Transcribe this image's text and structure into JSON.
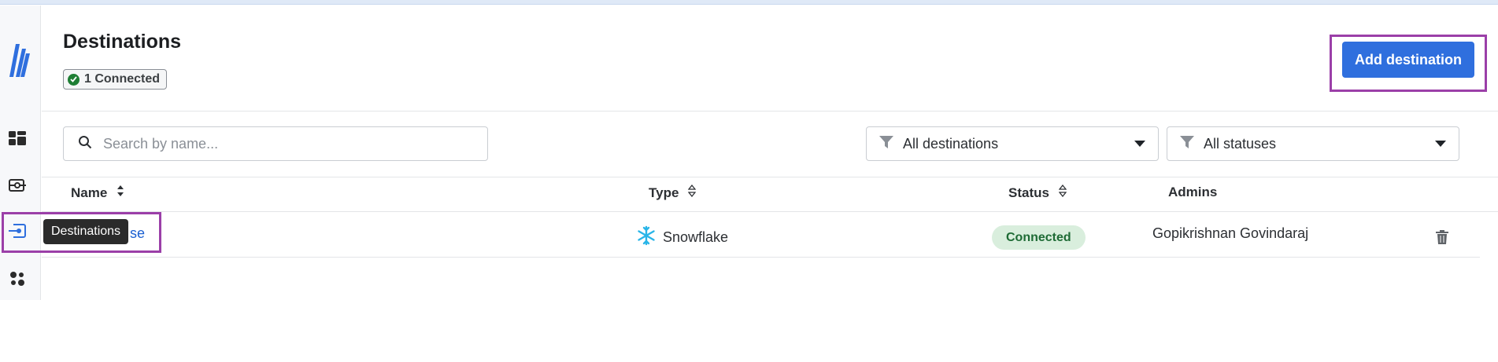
{
  "page": {
    "title": "Destinations",
    "connected_count": "1 Connected",
    "add_button": "Add destination"
  },
  "search": {
    "placeholder": "Search by name..."
  },
  "filters": {
    "destinations": "All destinations",
    "statuses": "All statuses"
  },
  "table": {
    "columns": {
      "name": "Name",
      "type": "Type",
      "status": "Status",
      "admins": "Admins"
    },
    "rows": [
      {
        "name": "se",
        "type": "Snowflake",
        "status": "Connected",
        "admins": "Gopikrishnan Govindaraj"
      }
    ]
  },
  "tooltip": {
    "text": "Destinations"
  },
  "sidebar": {
    "items": [
      {
        "icon": "dashboard-icon"
      },
      {
        "icon": "connections-icon"
      },
      {
        "icon": "destinations-icon",
        "active": true
      },
      {
        "icon": "transformations-icon"
      }
    ]
  },
  "colors": {
    "accent": "#2f6fde",
    "highlight": "#9b3fa8",
    "connected_bg": "#d9eedd",
    "connected_text": "#1e6b35",
    "snowflake": "#29b5e8"
  }
}
